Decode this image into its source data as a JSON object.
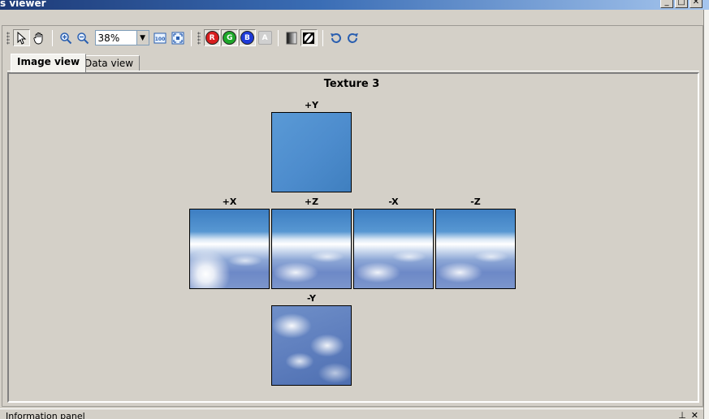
{
  "window": {
    "title": "s viewer",
    "controls": {
      "minimize": "_",
      "maximize": "□",
      "close": "✕"
    }
  },
  "toolbar": {
    "zoom_value": "38%",
    "channels": [
      {
        "letter": "R",
        "color": "#d81e1e"
      },
      {
        "letter": "G",
        "color": "#1ea82a"
      },
      {
        "letter": "B",
        "color": "#1e3ad8"
      },
      {
        "letter": "A",
        "color": "#c8c8c8"
      }
    ],
    "icons": [
      "select-arrow-icon",
      "pan-hand-icon",
      "zoom-in-icon",
      "zoom-out-icon",
      "actual-size-icon",
      "fit-to-window-icon",
      "gradient-icon",
      "invert-icon",
      "rotate-left-icon",
      "rotate-right-icon"
    ]
  },
  "tabs": [
    {
      "label": "Image view"
    },
    {
      "label": "Data view"
    }
  ],
  "viewer": {
    "texture_title": "Texture 3",
    "faces": {
      "pos_y": "+Y",
      "pos_x": "+X",
      "pos_z": "+Z",
      "neg_x": "-X",
      "neg_z": "-Z",
      "neg_y": "-Y"
    }
  },
  "info_panel": {
    "label": "Information panel",
    "pin": "⊥",
    "close": "✕"
  }
}
